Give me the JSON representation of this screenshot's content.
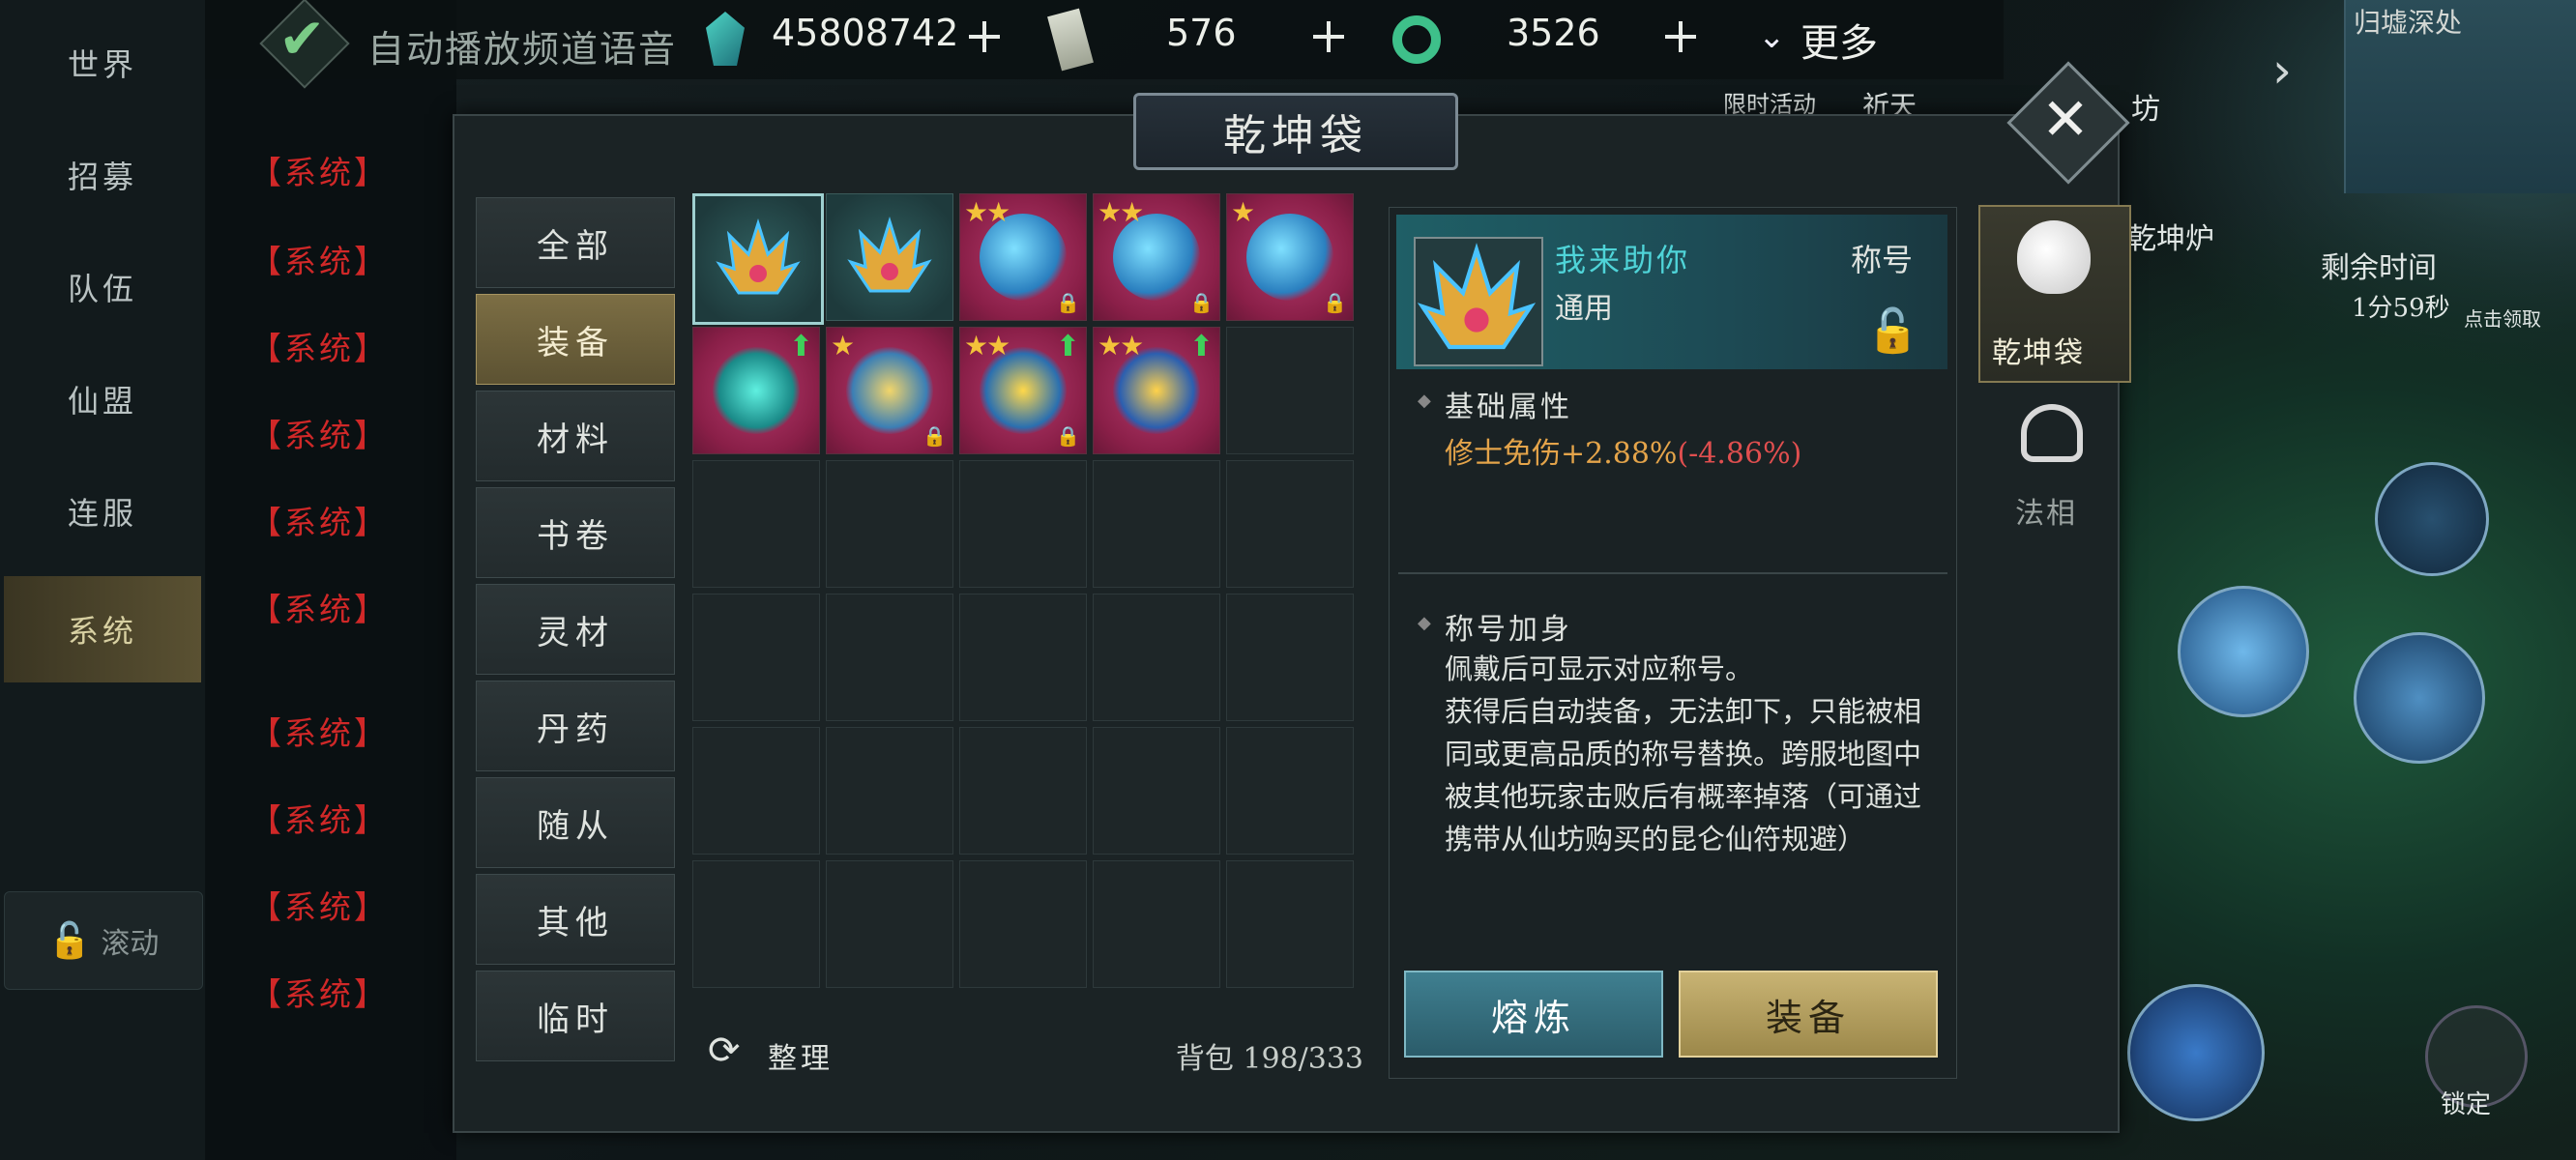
{
  "top_bar": {
    "auto_voice_label": "自动播放频道语音",
    "resources": [
      {
        "icon": "jade-crystal-icon",
        "value": "45808742"
      },
      {
        "icon": "scroll-ticket-icon",
        "value": "576"
      },
      {
        "icon": "green-ring-icon",
        "value": "3526"
      }
    ],
    "more_label": "更多"
  },
  "chat": {
    "tabs": [
      "世界",
      "招募",
      "队伍",
      "仙盟",
      "连服",
      "系统"
    ],
    "active_tab": "系统",
    "lines": [
      "【系统】",
      "【系统】",
      "【系统】",
      "【系统】",
      "【系统】",
      "【系统】",
      "【系统】",
      "【系统】",
      "【系统】",
      "【系统】"
    ],
    "scroll_label": "滚动"
  },
  "dialog": {
    "title": "乾坤袋",
    "categories": [
      "全部",
      "装备",
      "材料",
      "书卷",
      "灵材",
      "丹药",
      "随从",
      "其他",
      "临时"
    ],
    "active_category": "装备",
    "sort_label": "整理",
    "capacity_label": "背包 198/333"
  },
  "detail": {
    "name": "我来助你",
    "category": "称号",
    "type": "通用",
    "base_attr_title": "基础属性",
    "stat": "修士免伤+2.88%",
    "stat_delta": "(-4.86%)",
    "effect_title": "称号加身",
    "description": "佩戴后可显示对应称号。\n获得后自动装备，无法卸下，只能被相同或更高品质的称号替换。跨服地图中被其他玩家击败后有概率掉落（可通过携带从仙坊购买的昆仑仙符规避）",
    "smelt_label": "熔炼",
    "equip_label": "装备"
  },
  "side_tabs": [
    {
      "label": "乾坤袋",
      "icon": "pouch-icon",
      "active": true
    },
    {
      "label": "法相",
      "icon": "dharma-icon",
      "active": false
    }
  ],
  "hud": {
    "event_label": "限时活动",
    "pray_label": "祈天",
    "workshop_label": "坊",
    "furnace_label": "乾坤炉",
    "location": "归墟深处",
    "remaining_label": "剩余时间",
    "remaining_value": "1分59秒",
    "click_hint": "点击领取",
    "lock_label": "锁定"
  },
  "colors": {
    "system_red": "#d02828",
    "accent_gold": "#c8b373",
    "accent_teal": "#4fd4d8",
    "stat_orange": "#e4a44a"
  }
}
